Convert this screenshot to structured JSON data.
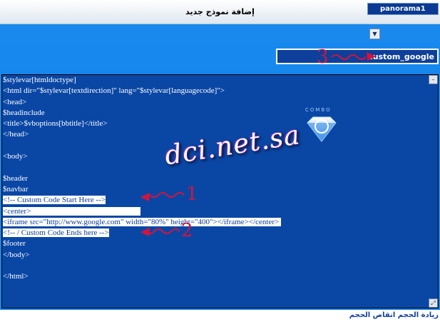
{
  "window": {
    "title": "إضافة نموذج جديد"
  },
  "style_select": {
    "selected": "panorama1"
  },
  "template_name_input": {
    "value": "custom_google"
  },
  "editor": {
    "lines": [
      {
        "text": "$stylevar[htmldoctype]",
        "highlight": false
      },
      {
        "text": "<html dir=\"$stylevar[textdirection]\" lang=\"$stylevar[languagecode]\">",
        "highlight": false
      },
      {
        "text": "<head>",
        "highlight": false
      },
      {
        "text": "$headinclude",
        "highlight": false
      },
      {
        "text": "<title>$vboptions[bbtitle]</title>",
        "highlight": false
      },
      {
        "text": "</head>",
        "highlight": false
      },
      {
        "text": "",
        "highlight": false
      },
      {
        "text": "<body>",
        "highlight": false
      },
      {
        "text": "",
        "highlight": false
      },
      {
        "text": "$header",
        "highlight": false
      },
      {
        "text": "$navbar",
        "highlight": false
      },
      {
        "text": "<!-- Custom Code Start Here -->",
        "highlight": true
      },
      {
        "text": "<center>                                                        ",
        "highlight": true
      },
      {
        "text": "<iframe src=\"http://www.google.com\" width=\"80%\" height=\"400\"></iframe></center> ",
        "highlight": true
      },
      {
        "text": "<!-- / Custom Code Ends here -->",
        "highlight": true
      },
      {
        "text": "$footer",
        "highlight": false
      },
      {
        "text": "</body>",
        "highlight": false
      },
      {
        "text": "",
        "highlight": false
      },
      {
        "text": "</html>",
        "highlight": false
      }
    ]
  },
  "watermark": {
    "text": "dci.net.sa"
  },
  "logo": {
    "text": "COMBO"
  },
  "annotations": {
    "one": "1",
    "two": "2",
    "three": "3"
  },
  "footer": {
    "increase_size": "زيادة الحجم",
    "decrease_size": "انقاص الحجم"
  },
  "icons": {
    "select_arrow": "chevron-down-icon",
    "scroll_up": "scroll-up-icon",
    "scroll_down": "scroll-down-icon"
  },
  "colors": {
    "accent_blue": "#1789ee",
    "editor_bg": "#0a47a5",
    "annotation_red": "#d4143c"
  }
}
